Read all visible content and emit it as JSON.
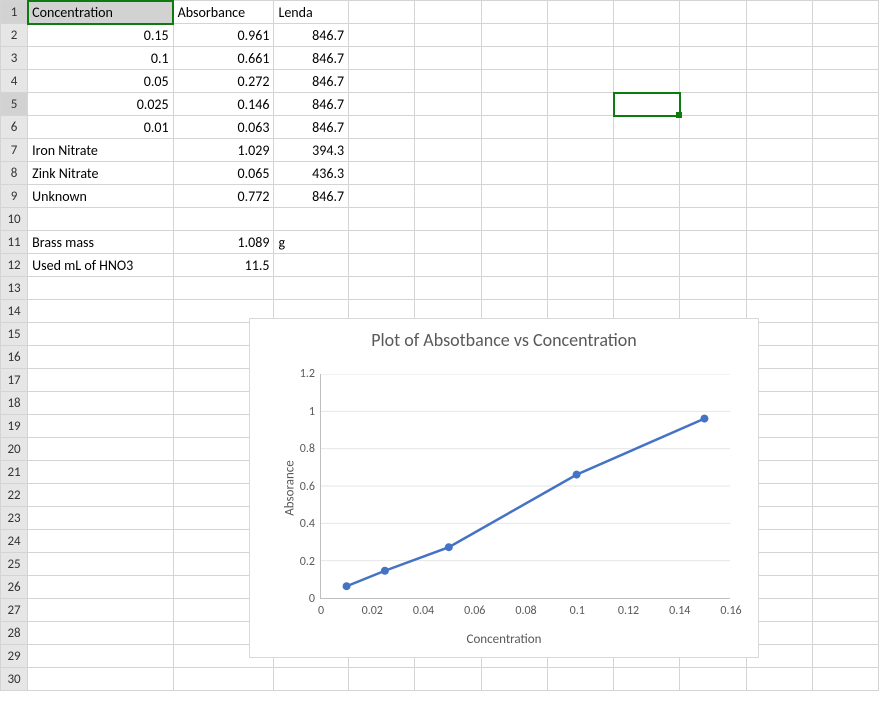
{
  "headers": {
    "A": "Concentration",
    "B": "Absorbance",
    "C": "Lenda"
  },
  "rows": [
    {
      "A": "0.15",
      "B": "0.961",
      "C": "846.7"
    },
    {
      "A": "0.1",
      "B": "0.661",
      "C": "846.7"
    },
    {
      "A": "0.05",
      "B": "0.272",
      "C": "846.7"
    },
    {
      "A": "0.025",
      "B": "0.146",
      "C": "846.7"
    },
    {
      "A": "0.01",
      "B": "0.063",
      "C": "846.7"
    }
  ],
  "labeled": [
    {
      "A": "Iron Nitrate",
      "B": "1.029",
      "C": "394.3"
    },
    {
      "A": "Zink Nitrate",
      "B": "0.065",
      "C": "436.3"
    },
    {
      "A": "Unknown",
      "B": "0.772",
      "C": "846.7"
    }
  ],
  "meta": [
    {
      "A": "Brass mass",
      "B": "1.089",
      "C": "g"
    },
    {
      "A": "Used mL of HNO3",
      "B": "11.5",
      "C": ""
    }
  ],
  "row_numbers": [
    "1",
    "2",
    "3",
    "4",
    "5",
    "6",
    "7",
    "8",
    "9",
    "10",
    "11",
    "12",
    "13",
    "14",
    "15",
    "16",
    "17",
    "18",
    "19",
    "20",
    "21",
    "22",
    "23",
    "24",
    "25",
    "26",
    "27",
    "28",
    "29",
    "30"
  ],
  "chart": {
    "title": "Plot of Absotbance vs Concentration",
    "xlabel": "Concentration",
    "ylabel": "Absorance",
    "yticks": [
      "0",
      "0.2",
      "0.4",
      "0.6",
      "0.8",
      "1",
      "1.2"
    ],
    "xticks": [
      "0",
      "0.02",
      "0.04",
      "0.06",
      "0.08",
      "0.1",
      "0.12",
      "0.14",
      "0.16"
    ]
  },
  "chart_data": {
    "type": "line",
    "x": [
      0.01,
      0.025,
      0.05,
      0.1,
      0.15
    ],
    "y": [
      0.063,
      0.146,
      0.272,
      0.661,
      0.961
    ],
    "title": "Plot of Absotbance vs Concentration",
    "xlabel": "Concentration",
    "ylabel": "Absorance",
    "xlim": [
      0,
      0.16
    ],
    "ylim": [
      0,
      1.2
    ]
  }
}
